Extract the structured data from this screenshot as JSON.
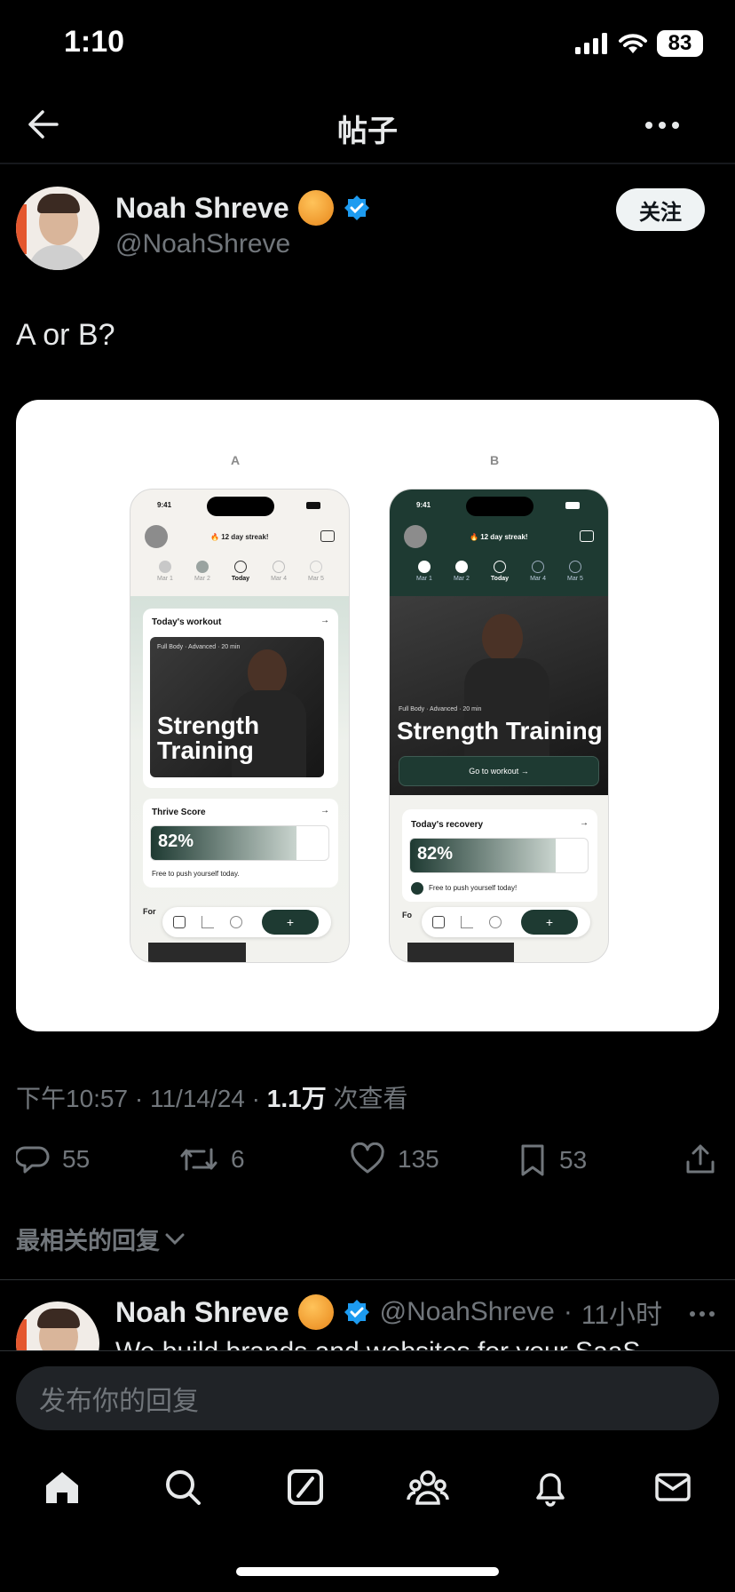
{
  "status": {
    "time": "1:10",
    "battery": "83"
  },
  "nav": {
    "title": "帖子"
  },
  "post": {
    "author": "Noah Shreve",
    "handle": "@NoahShreve",
    "follow_label": "关注",
    "text": "A or B?",
    "meta": {
      "time": "下午10:57",
      "date": "11/14/24",
      "views_num": "1.1万",
      "views_label": "次查看"
    },
    "stats": {
      "replies": "55",
      "reposts": "6",
      "likes": "135",
      "bookmarks": "53"
    }
  },
  "mockup": {
    "label_a": "A",
    "label_b": "B",
    "phone_time": "9:41",
    "streak": "12 day streak!",
    "days": [
      "Mar 1",
      "Mar 2",
      "Today",
      "Mar 4",
      "Mar 5"
    ],
    "a": {
      "workout_title": "Today's workout",
      "tags": [
        "Full Body",
        "Advanced",
        "20 min"
      ],
      "hero": "Strength Training",
      "score_title": "Thrive Score",
      "score": "82%",
      "score_note": "Free to push yourself today.",
      "section": "For"
    },
    "b": {
      "tags": [
        "Full Body",
        "Advanced",
        "20 min"
      ],
      "hero": "Strength Training",
      "cta": "Go to workout",
      "recovery_title": "Today's recovery",
      "score": "82%",
      "score_note": "Free to push yourself today!",
      "section": "Fo"
    }
  },
  "replies": {
    "sort_label": "最相关的回复",
    "items": [
      {
        "author": "Noah Shreve",
        "handle": "@NoahShreve",
        "time": "11小时",
        "text": "We build brands and websites for your SaaS"
      }
    ]
  },
  "composer": {
    "placeholder": "发布你的回复"
  },
  "colors": {
    "accent": "#1d9bf0",
    "dark_green": "#1e3a32"
  }
}
